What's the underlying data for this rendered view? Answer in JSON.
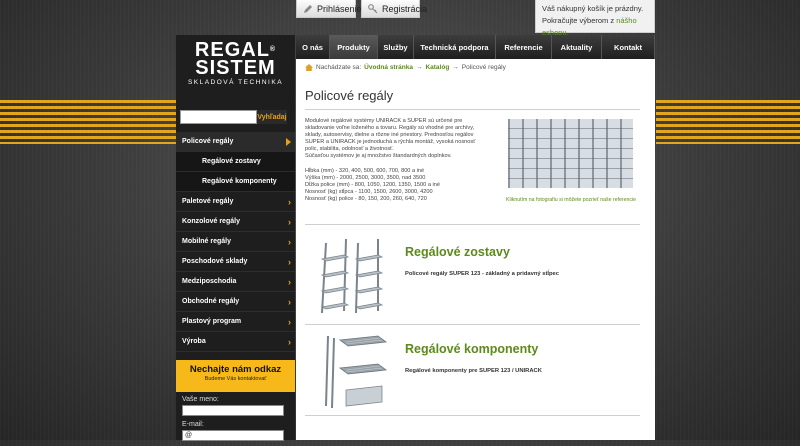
{
  "top": {
    "login": "Prihlásenie",
    "register": "Registrácia",
    "cart_line1": "Váš nákupný košík je prázdny.",
    "cart_line2": "Pokračujte výberom z",
    "cart_link": "nášho eshopu."
  },
  "logo": {
    "line1": "REGAL",
    "line2": "SISTEM",
    "sub": "SKLADOVÁ TECHNIKA",
    "reg": "®"
  },
  "search": {
    "button": "Vyhľadaj"
  },
  "sidebar": {
    "items": [
      {
        "label": "Policové regály"
      },
      {
        "label": "Regálové zostavy"
      },
      {
        "label": "Regálové komponenty"
      },
      {
        "label": "Paletové regály"
      },
      {
        "label": "Konzolové regály"
      },
      {
        "label": "Mobilné regály"
      },
      {
        "label": "Poschodové sklady"
      },
      {
        "label": "Medziposchodia"
      },
      {
        "label": "Obchodné regály"
      },
      {
        "label": "Plastový program"
      },
      {
        "label": "Výroba"
      }
    ]
  },
  "find": {
    "title": "Nechajte nám odkaz",
    "sub": "Budeme Vás kontaktovať"
  },
  "form": {
    "name_label": "Vaše meno:",
    "email_label": "E-mail:",
    "email_value": "@"
  },
  "nav": {
    "tabs": [
      "O nás",
      "Produkty",
      "Služby",
      "Technická podpora",
      "Referencie",
      "Aktuality",
      "Kontakt"
    ]
  },
  "breadcrumb": {
    "prefix": "Nachádzate sa:",
    "home": "Úvodná stránka",
    "sep1": "→",
    "catalog": "Katalóg",
    "sep2": "→",
    "current": "Policové regály"
  },
  "page": {
    "title": "Policové regály",
    "intro": [
      "Modulové regálové systémy UNIRACK a SUPER sú určené pre",
      "skladovanie voľne loženého a tovaru. Regály sú vhodné pre archívy,",
      "sklady, autoservisy, dielne a rôzne iné priestory. Prednosťou regálov",
      "SUPER a UNIRACK je jednoduchá a rýchla montáž, vysoká nosnosť",
      "polic, stabilita, odolnosť a životnosť.",
      "Súčasťou systémov je aj množstvo štandardných doplnkov.",
      "",
      "Hĺbka (mm) - 320, 400, 500, 600, 700, 800 a iné",
      "Výška (mm) - 2000, 2500, 3000, 3500, nad 3500",
      "Dĺžka police (mm) - 800, 1050, 1200, 1350, 1500 a iné",
      "Nosnosť (kg) stĺpca - 1100, 1500, 2600, 3000, 4200",
      "Nosnosť (kg) police - 80, 150, 200, 260, 640, 720"
    ],
    "photo_caption": "Kliknutím na fotografiu si môžete pozrieť naše referencie"
  },
  "products": [
    {
      "title": "Regálové zostavy",
      "desc": "Policové regály SUPER 123 - základný a pridavný stĺpec"
    },
    {
      "title": "Regálové komponenty",
      "desc": "Regálové komponenty pre SUPER 123 / UNIRACK"
    }
  ],
  "colors": {
    "accent": "#e6a119",
    "green": "#5c8a1c",
    "sidebar": "#1e1e1e"
  }
}
